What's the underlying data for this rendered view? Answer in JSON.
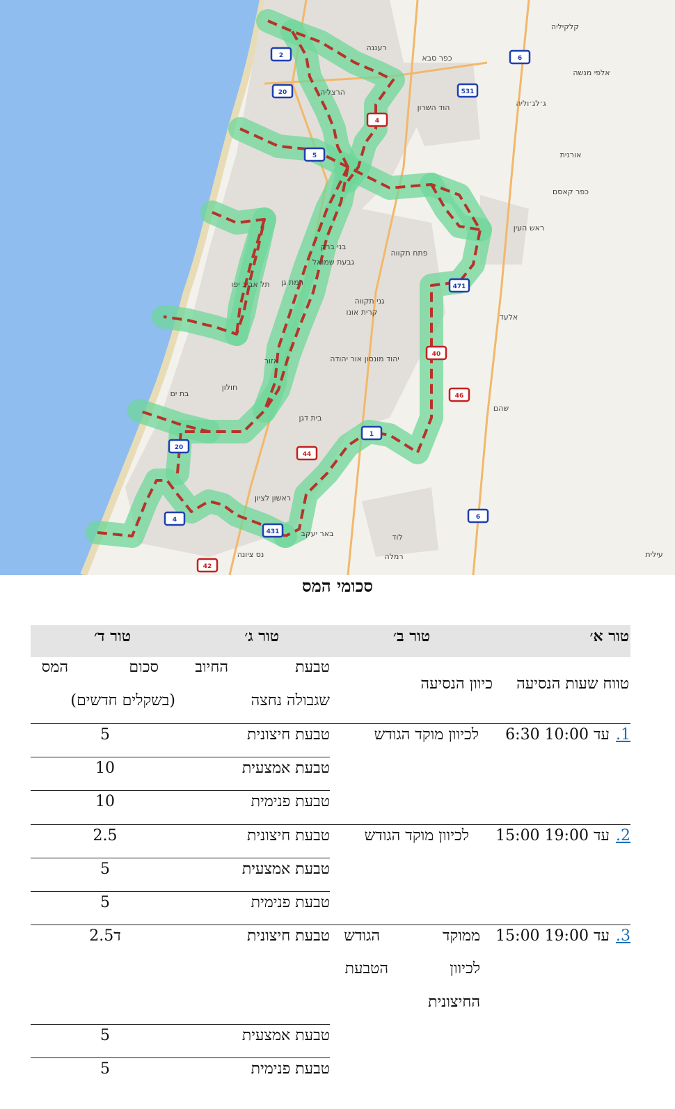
{
  "map": {
    "cities": [
      {
        "id": "kalkilya",
        "label": "קלקיליה"
      },
      {
        "id": "raanana",
        "label": "רעננה"
      },
      {
        "id": "kfar_saba",
        "label": "כפר סבא"
      },
      {
        "id": "herzliya",
        "label": "הרצליה"
      },
      {
        "id": "hod_hasharon",
        "label": "הוד השרון"
      },
      {
        "id": "kfar_kasem",
        "label": "כפר קאסם"
      },
      {
        "id": "rosh_haayin",
        "label": "ראש העין"
      },
      {
        "id": "bnei_brak",
        "label": "בני ברק"
      },
      {
        "id": "petah_tikva",
        "label": "פתח תקווה"
      },
      {
        "id": "givat_shmuel",
        "label": "גבעת שמואל"
      },
      {
        "id": "tel_aviv",
        "label": "תל אביב יפו"
      },
      {
        "id": "ramat_gan",
        "label": "רמת גן"
      },
      {
        "id": "ganei_tikva",
        "label": "גני תקווה"
      },
      {
        "id": "kiryat_ono",
        "label": "קרית אונו"
      },
      {
        "id": "elad",
        "label": "אלעד"
      },
      {
        "id": "or_yehuda",
        "label": "יהוד מונסון אור יהודה"
      },
      {
        "id": "azor",
        "label": "אזור"
      },
      {
        "id": "holon",
        "label": "חולון"
      },
      {
        "id": "bat_yam",
        "label": "בת ים"
      },
      {
        "id": "beit_dagan",
        "label": "בית דגן"
      },
      {
        "id": "rishon",
        "label": "ראשון לציון"
      },
      {
        "id": "lod",
        "label": "לוד"
      },
      {
        "id": "nes_ziona",
        "label": "נס ציונה"
      },
      {
        "id": "ramla",
        "label": "רמלה"
      },
      {
        "id": "beer_yaakov",
        "label": "באר יעקב"
      },
      {
        "id": "oranit",
        "label": "אורנית"
      },
      {
        "id": "elei_menashe",
        "label": "אלפי מנשה"
      },
      {
        "id": "jaljulia",
        "label": "ג׳לג׳וליה"
      },
      {
        "id": "shoham",
        "label": "שהם"
      },
      {
        "id": "ilit",
        "label": "עילית"
      }
    ],
    "road_shields": [
      {
        "id": "r2",
        "label": "2",
        "color": "#1d3fb0"
      },
      {
        "id": "r6a",
        "label": "6",
        "color": "#1d3fb0"
      },
      {
        "id": "r20",
        "label": "20",
        "color": "#1d3fb0"
      },
      {
        "id": "r531",
        "label": "531",
        "color": "#1d3fb0"
      },
      {
        "id": "r4a",
        "label": "4",
        "color": "#c42020"
      },
      {
        "id": "r5",
        "label": "5",
        "color": "#1d3fb0"
      },
      {
        "id": "r471",
        "label": "471",
        "color": "#1d3fb0"
      },
      {
        "id": "r40",
        "label": "40",
        "color": "#c42020"
      },
      {
        "id": "r46",
        "label": "46",
        "color": "#c42020"
      },
      {
        "id": "r20b",
        "label": "20",
        "color": "#1d3fb0"
      },
      {
        "id": "r1",
        "label": "1",
        "color": "#1d3fb0"
      },
      {
        "id": "r44",
        "label": "44",
        "color": "#c42020"
      },
      {
        "id": "r4b",
        "label": "4",
        "color": "#1d3fb0"
      },
      {
        "id": "r431",
        "label": "431",
        "color": "#1d3fb0"
      },
      {
        "id": "r6b",
        "label": "6",
        "color": "#1d3fb0"
      },
      {
        "id": "r42",
        "label": "42",
        "color": "#c42020"
      }
    ],
    "colors": {
      "sea": "#8fbdf0",
      "land": "#f3f1ec",
      "corridor": "#6fd79a",
      "route": "#b5342a"
    }
  },
  "title": "סכומי המס",
  "header": {
    "a": "טור א׳",
    "b": "טור ב׳",
    "c": "טור ג׳",
    "d": "טור ד׳"
  },
  "colheads": {
    "a_line1": "טווח שעות הנסיעה",
    "b_line1": "כיוון הנסיעה",
    "c_line1": "טבעת",
    "c_line2": "שגבולה נחצה",
    "d_line1a": "החיוב",
    "d_line1b": "סכום",
    "d_line1c": "המס",
    "d_line2": "(בשקלים חדשים)"
  },
  "rows": {
    "r1_num": "1.",
    "r1_time": "6:30 עד 10:00",
    "r1_dir": "לכיוון מוקד הגודש",
    "r1_ring1": "טבעת חיצונית",
    "r1_amt1": "5",
    "r1_ring2": "טבעת אמצעית",
    "r1_amt2": "10",
    "r1_ring3": "טבעת פנימית",
    "r1_amt3": "10",
    "r2_num": "2.",
    "r2_time": "15:00 עד 19:00",
    "r2_dir": "לכיוון מוקד הגודש",
    "r2_ring1": "טבעת חיצונית",
    "r2_amt1": "2.5",
    "r2_ring2": "טבעת אמצעית",
    "r2_amt2": "5",
    "r2_ring3": "טבעת פנימית",
    "r2_amt3": "5",
    "r3_num": "3.",
    "r3_time": "15:00 עד 19:00",
    "r3_dir1": "ממוקד",
    "r3_dir2": "הגודש",
    "r3_dir3": "לכיוון",
    "r3_dir4": "הטבעת",
    "r3_dir5": "החיצונית",
    "r3_ring1": "טבעת חיצונית",
    "r3_amt1": "2.5ד",
    "r3_ring2": "טבעת אמצעית",
    "r3_amt2": "5",
    "r3_ring3": "טבעת פנימית",
    "r3_amt3": "5"
  }
}
